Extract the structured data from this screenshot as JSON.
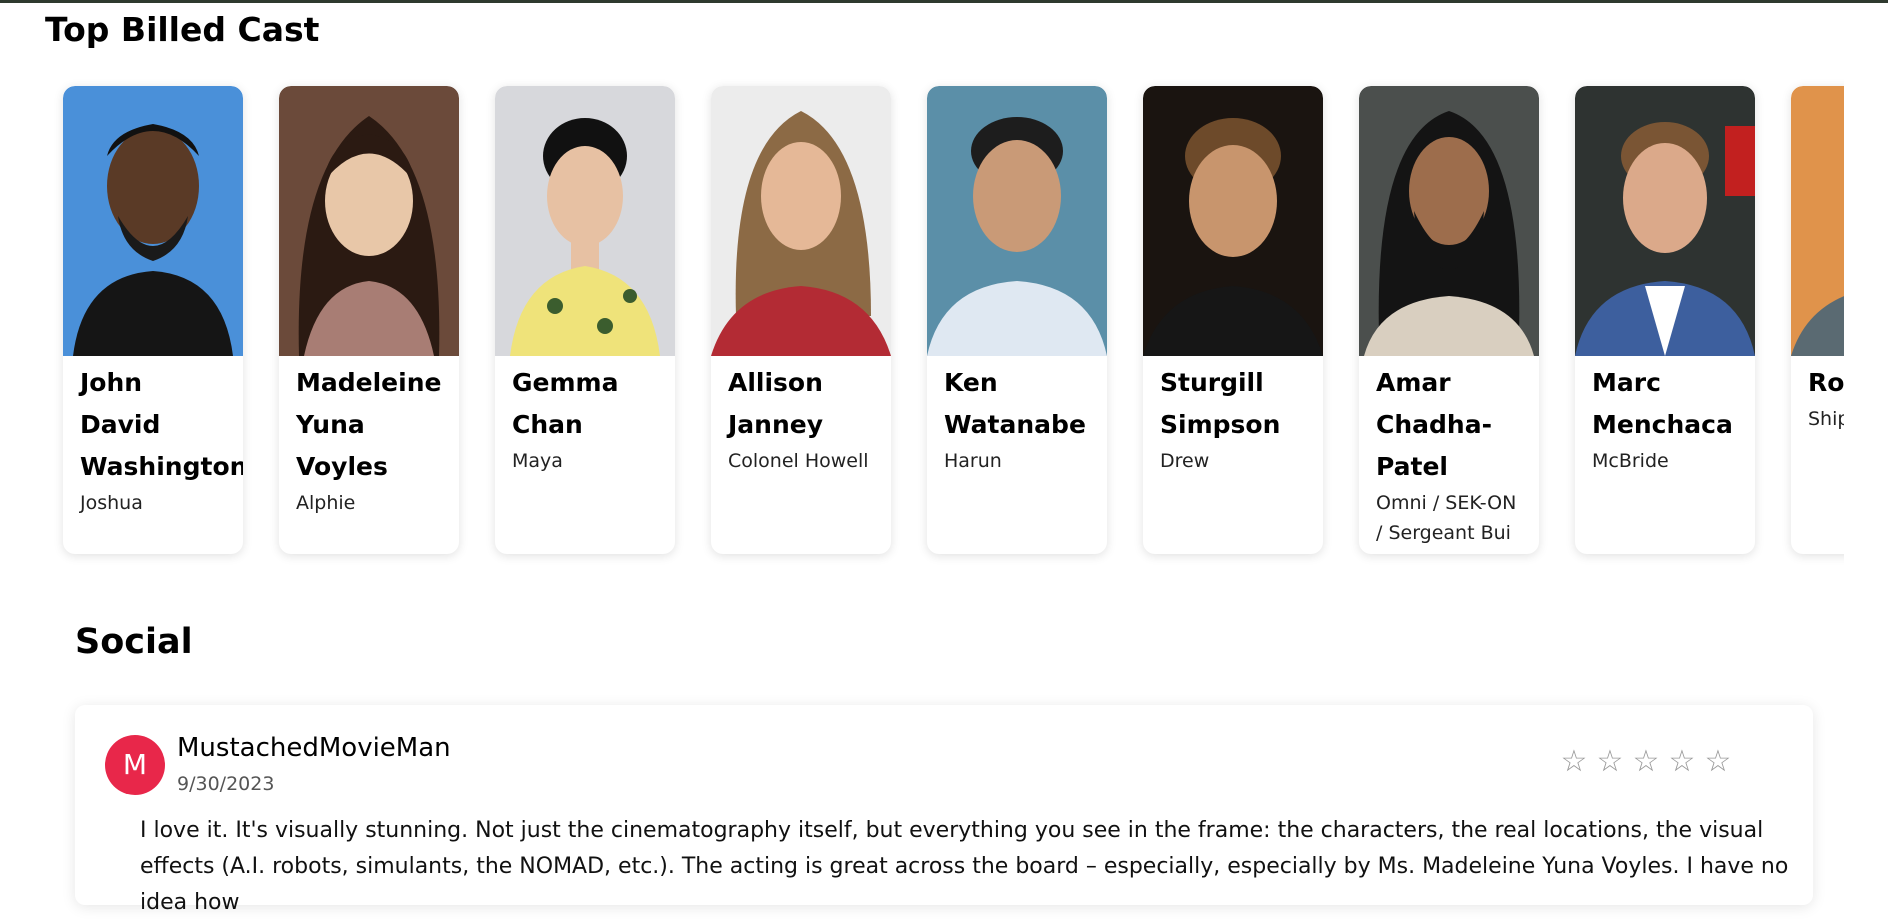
{
  "cast_section": {
    "title": "Top Billed Cast",
    "members": [
      {
        "name": "John David Washington",
        "character": "Joshua",
        "photo_icon": "portrait-john-david-washington"
      },
      {
        "name": "Madeleine Yuna Voyles",
        "character": "Alphie",
        "photo_icon": "portrait-madeleine-yuna-voyles"
      },
      {
        "name": "Gemma Chan",
        "character": "Maya",
        "photo_icon": "portrait-gemma-chan"
      },
      {
        "name": "Allison Janney",
        "character": "Colonel Howell",
        "photo_icon": "portrait-allison-janney"
      },
      {
        "name": "Ken Watanabe",
        "character": "Harun",
        "photo_icon": "portrait-ken-watanabe"
      },
      {
        "name": "Sturgill Simpson",
        "character": "Drew",
        "photo_icon": "portrait-sturgill-simpson"
      },
      {
        "name": "Amar Chadha-Patel",
        "character": "Omni / SEK-ON / Sergeant Bui",
        "photo_icon": "portrait-amar-chadha-patel"
      },
      {
        "name": "Marc Menchaca",
        "character": "McBride",
        "photo_icon": "portrait-marc-menchaca"
      },
      {
        "name": "Rol",
        "character": "Ship",
        "photo_icon": "portrait-partial"
      }
    ]
  },
  "social_section": {
    "title": "Social",
    "review": {
      "avatar_letter": "M",
      "avatar_color": "#e8274a",
      "author": "MustachedMovieMan",
      "date": "9/30/2023",
      "rating_stars": 0,
      "max_stars": 5,
      "text": "I love it. It's visually stunning. Not just the cinematography itself, but everything you see in the frame: the characters, the real locations, the visual effects (A.I. robots, simulants, the NOMAD, etc.). The acting is great across the board – especially, especially by Ms. Madeleine Yuna Voyles. I have no idea how"
    }
  }
}
